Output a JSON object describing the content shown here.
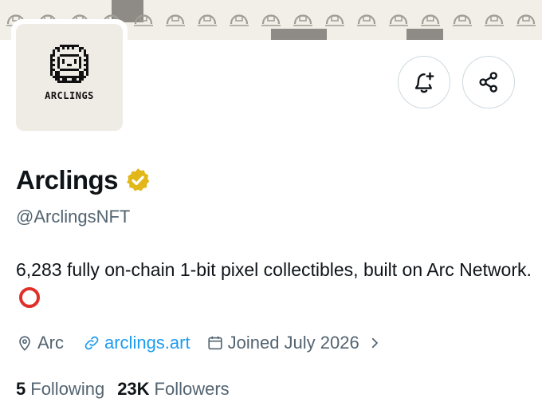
{
  "banner": {
    "icon": "pixel-creature-pattern"
  },
  "avatar": {
    "logo_icon": "arclings-pixel-creature",
    "wordmark": "ARCLINGS"
  },
  "actions": {
    "notify_icon": "bell-plus-icon",
    "share_icon": "share-icon"
  },
  "profile": {
    "display_name": "Arclings",
    "verified_icon": "verified-badge-icon",
    "verified_color": "#e2b719",
    "handle": "@ArclingsNFT",
    "bio": "6,283 fully on-chain 1-bit pixel collectibles, built on Arc Network.",
    "bio_emoji": "red-circle-emoji",
    "location": "Arc",
    "website": "arclings.art",
    "joined": "Joined July 2026"
  },
  "stats": {
    "following_count": "5",
    "following_label": "Following",
    "followers_count": "23K",
    "followers_label": "Followers"
  },
  "colors": {
    "text_primary": "#0f1419",
    "text_secondary": "#536471",
    "link": "#1d9bf0",
    "border": "#cfd9de",
    "emoji_red": "#e0302a"
  }
}
